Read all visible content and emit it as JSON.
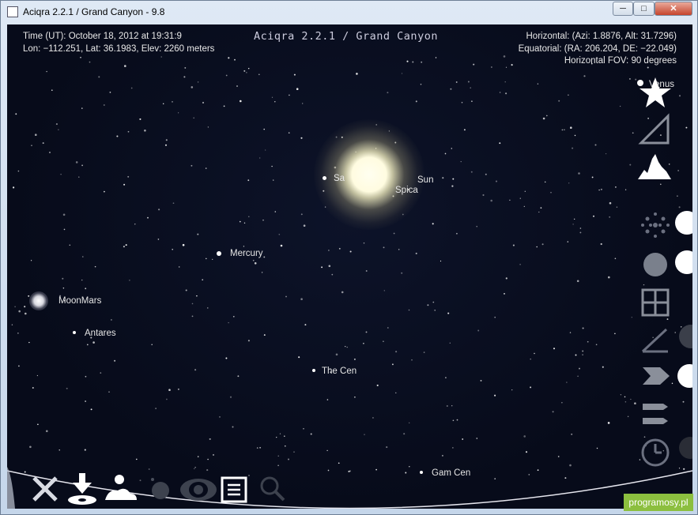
{
  "window": {
    "title": "Aciqra 2.2.1 / Grand Canyon - 9.8",
    "minimize_symbol": "─",
    "maximize_symbol": "□",
    "close_symbol": "✕"
  },
  "hud": {
    "time": "Time (UT): October 18, 2012 at 19:31:9",
    "location": "Lon: −112.251, Lat: 36.1983, Elev: 2260 meters",
    "center_title": "Aciqra 2.2.1 / Grand Canyon",
    "horizontal": "Horizontal: (Azi: 1.8876, Alt: 31.7296)",
    "equatorial": "Equatorial: (RA: 206.204, DE: −22.049)",
    "fov": "Horizontal FOV: 90 degrees"
  },
  "sky_labels": {
    "venus": "Venus",
    "sa": "Sa",
    "sun": "Sun",
    "spica": "Spica",
    "mercury": "Mercury",
    "moonmars": "MoonMars",
    "antares": "Antares",
    "the_cen": "The Cen",
    "gam_cen": "Gam Cen"
  },
  "right_toolbar_icons": [
    "star-icon",
    "triangle-icon",
    "mountain-icon",
    "cluster-icon",
    "circle-icon",
    "grid-icon",
    "angle-icon",
    "arrow-icon",
    "lines-icon",
    "clock-icon"
  ],
  "bottom_toolbar_icons": [
    "close-x-icon",
    "download-icon",
    "scene-icon",
    "planet-icon",
    "eye-icon",
    "menu-icon",
    "search-icon"
  ],
  "watermark": "programosy.pl"
}
